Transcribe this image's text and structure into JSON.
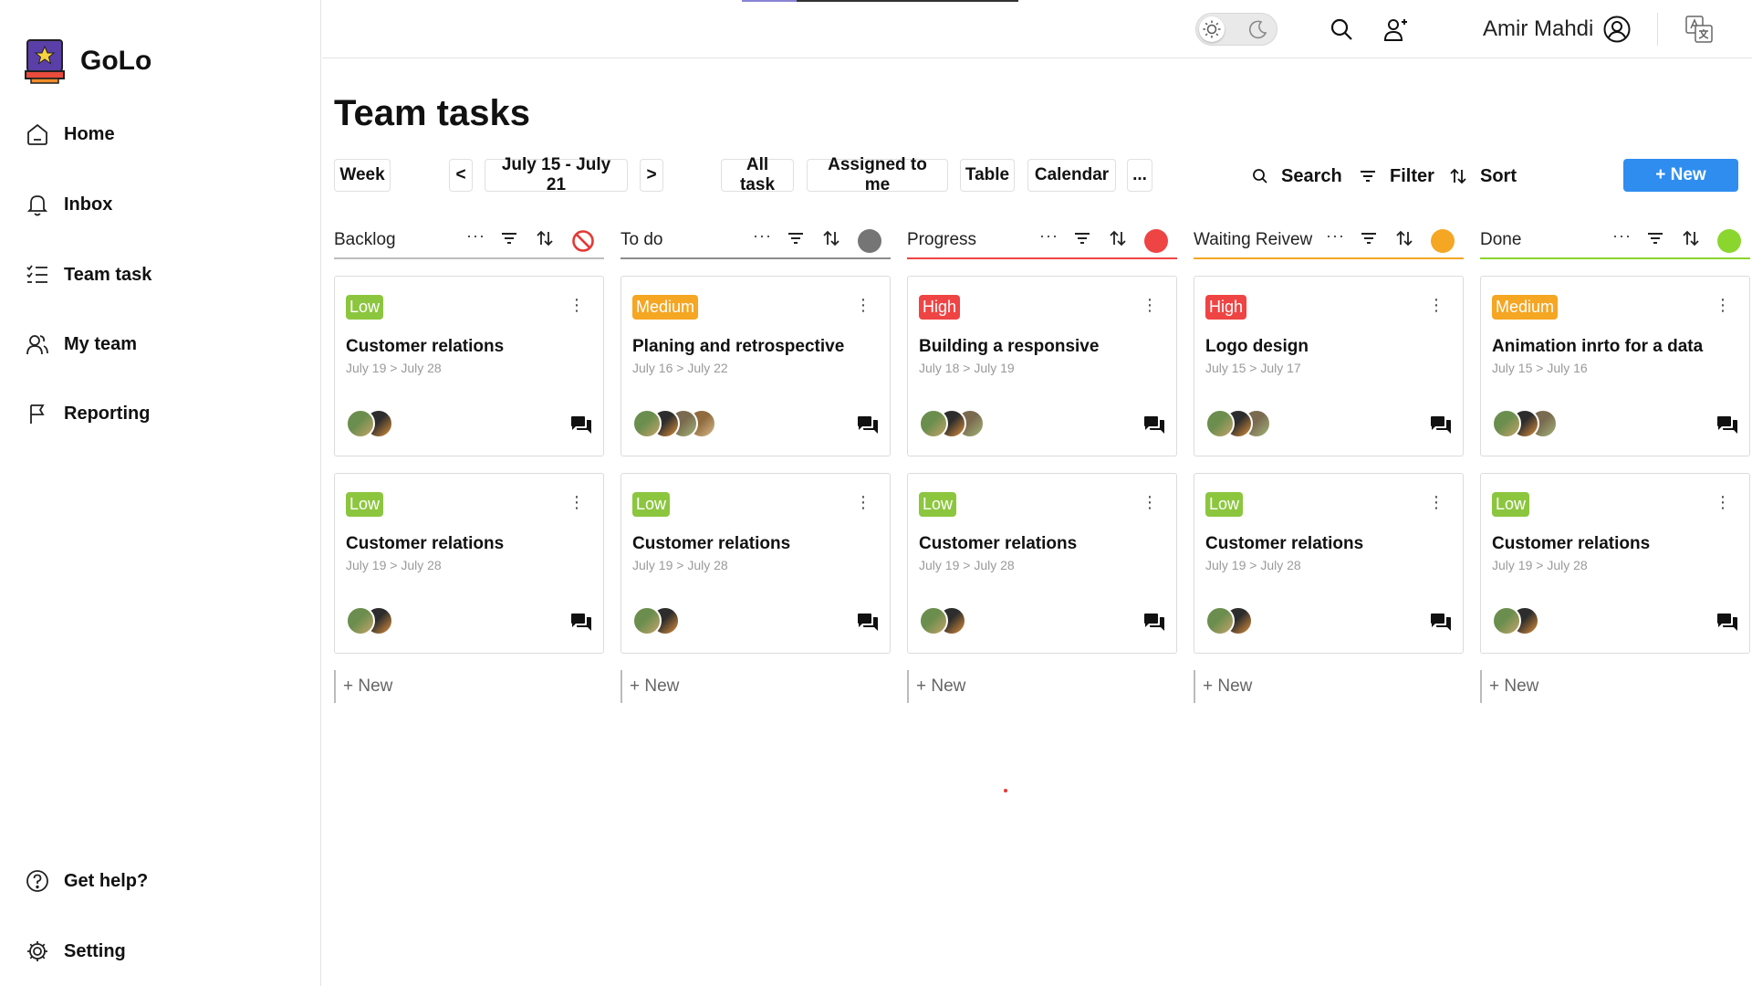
{
  "app": {
    "name": "GoLo"
  },
  "sidebar": {
    "items": [
      {
        "id": "home",
        "label": "Home",
        "icon": "home-icon"
      },
      {
        "id": "inbox",
        "label": "Inbox",
        "icon": "bell-icon"
      },
      {
        "id": "team-task",
        "label": "Team task",
        "icon": "checklist-icon"
      },
      {
        "id": "my-team",
        "label": "My team",
        "icon": "team-icon"
      },
      {
        "id": "reporting",
        "label": "Reporting",
        "icon": "flag-icon"
      }
    ],
    "bottom": [
      {
        "id": "help",
        "label": "Get help?",
        "icon": "help-icon"
      },
      {
        "id": "setting",
        "label": "Setting",
        "icon": "gear-icon"
      }
    ]
  },
  "topbar": {
    "user_name": "Amir Mahdi",
    "icons": [
      "sun-icon",
      "moon-icon",
      "search-icon",
      "add-user-icon",
      "user-circle-icon",
      "translate-icon"
    ]
  },
  "page": {
    "title": "Team tasks"
  },
  "toolbar": {
    "week": "Week",
    "prev": "<",
    "range": "July 15 - July 21",
    "next": ">",
    "all_task": "All task",
    "assigned": "Assigned to me",
    "table": "Table",
    "calendar": "Calendar",
    "more": "...",
    "search": "Search",
    "filter": "Filter",
    "sort": "Sort",
    "new": "+ New"
  },
  "colors": {
    "low": "#8cc63f",
    "medium": "#f5a623",
    "high": "#ef4444",
    "accent": "#2f8df0"
  },
  "columns": [
    {
      "name": "Backlog",
      "line_color": "#bdbdbd",
      "status_color": "#e53935",
      "status_type": "blocked",
      "new_label": "+ New",
      "cards": [
        {
          "priority": "Low",
          "title": "Customer relations",
          "dates": "July 19 > July 28",
          "avatars": 2
        },
        {
          "priority": "Low",
          "title": "Customer relations",
          "dates": "July 19 > July 28",
          "avatars": 2
        }
      ]
    },
    {
      "name": "To do",
      "line_color": "#8c8c8c",
      "status_color": "#757575",
      "status_type": "dot",
      "new_label": "+ New",
      "cards": [
        {
          "priority": "Medium",
          "title": "Planing and retrospective",
          "dates": "July 16 > July 22",
          "avatars": 4
        },
        {
          "priority": "Low",
          "title": "Customer relations",
          "dates": "July 19 > July 28",
          "avatars": 2
        }
      ]
    },
    {
      "name": "Progress",
      "line_color": "#ef4444",
      "status_color": "#ef4444",
      "status_type": "dot",
      "new_label": "+ New",
      "cards": [
        {
          "priority": "High",
          "title": "Building a responsive",
          "dates": "July 18 > July 19",
          "avatars": 3
        },
        {
          "priority": "Low",
          "title": "Customer relations",
          "dates": "July 19 > July 28",
          "avatars": 2
        }
      ]
    },
    {
      "name": "Waiting Reivew",
      "line_color": "#f5a623",
      "status_color": "#f5a623",
      "status_type": "dot",
      "new_label": "+ New",
      "cards": [
        {
          "priority": "High",
          "title": "Logo design",
          "dates": "July 15 > July 17",
          "avatars": 3
        },
        {
          "priority": "Low",
          "title": "Customer relations",
          "dates": "July 19 > July 28",
          "avatars": 2
        }
      ]
    },
    {
      "name": "Done",
      "line_color": "#8bd62e",
      "status_color": "#8bd62e",
      "status_type": "dot",
      "new_label": "+ New",
      "cards": [
        {
          "priority": "Medium",
          "title": "Animation inrto for a data",
          "dates": "July 15 > July 16",
          "avatars": 3
        },
        {
          "priority": "Low",
          "title": "Customer relations",
          "dates": "July 19 > July 28",
          "avatars": 2
        }
      ]
    }
  ]
}
